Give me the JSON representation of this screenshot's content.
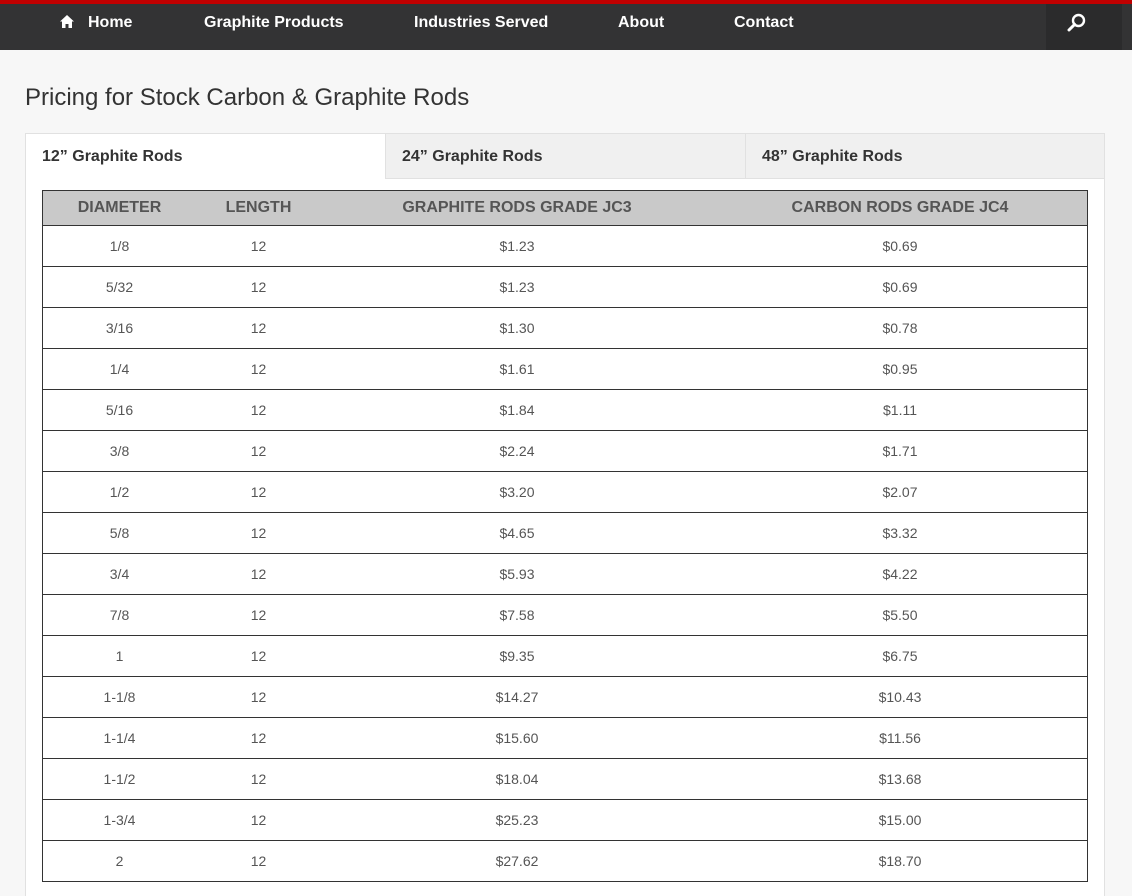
{
  "nav": {
    "home_label": "Home",
    "items": [
      "Graphite Products",
      "Industries Served",
      "About",
      "Contact"
    ],
    "search_icon": "search-icon",
    "accent_color": "#c00000"
  },
  "page": {
    "title": "Pricing for Stock Carbon & Graphite Rods"
  },
  "tabs": [
    "12” Graphite Rods",
    "24” Graphite Rods",
    "48” Graphite Rods"
  ],
  "table": {
    "headers": [
      "DIAMETER",
      "LENGTH",
      "GRAPHITE RODS GRADE JC3",
      "CARBON RODS GRADE JC4"
    ],
    "rows": [
      [
        "1/8",
        "12",
        "$1.23",
        "$0.69"
      ],
      [
        "5/32",
        "12",
        "$1.23",
        "$0.69"
      ],
      [
        "3/16",
        "12",
        "$1.30",
        "$0.78"
      ],
      [
        "1/4",
        "12",
        "$1.61",
        "$0.95"
      ],
      [
        "5/16",
        "12",
        "$1.84",
        "$1.11"
      ],
      [
        "3/8",
        "12",
        "$2.24",
        "$1.71"
      ],
      [
        "1/2",
        "12",
        "$3.20",
        "$2.07"
      ],
      [
        "5/8",
        "12",
        "$4.65",
        "$3.32"
      ],
      [
        "3/4",
        "12",
        "$5.93",
        "$4.22"
      ],
      [
        "7/8",
        "12",
        "$7.58",
        "$5.50"
      ],
      [
        "1",
        "12",
        "$9.35",
        "$6.75"
      ],
      [
        "1-1/8",
        "12",
        "$14.27",
        "$10.43"
      ],
      [
        "1-1/4",
        "12",
        "$15.60",
        "$11.56"
      ],
      [
        "1-1/2",
        "12",
        "$18.04",
        "$13.68"
      ],
      [
        "1-3/4",
        "12",
        "$25.23",
        "$15.00"
      ],
      [
        "2",
        "12",
        "$27.62",
        "$18.70"
      ]
    ]
  }
}
